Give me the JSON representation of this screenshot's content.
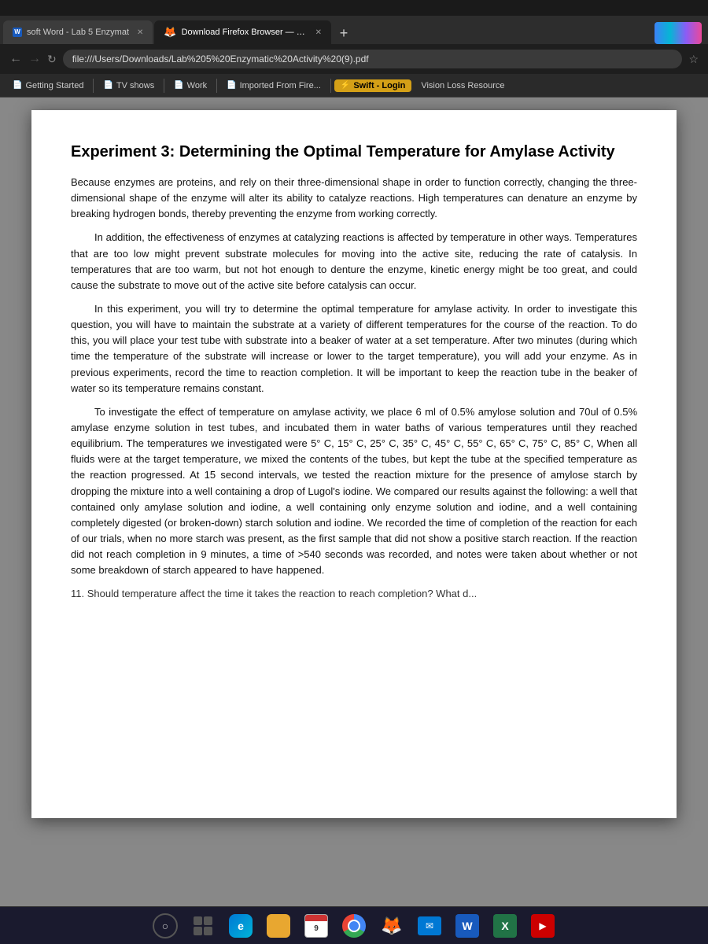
{
  "browser": {
    "tabs": [
      {
        "id": "tab1",
        "label": "soft Word - Lab 5 Enzymat",
        "active": false,
        "icon": "word-icon"
      },
      {
        "id": "tab2",
        "label": "Download Firefox Browser — Fas",
        "active": true,
        "icon": "firefox-icon"
      },
      {
        "id": "tab3",
        "label": "+",
        "active": false,
        "icon": ""
      }
    ],
    "address": "file:///Users/Downloads/Lab%205%20Enzymatic%20Activity%20(9).pdf",
    "bookmarks": [
      {
        "label": "Getting Started",
        "icon": "bookmark-icon"
      },
      {
        "label": "TV shows",
        "icon": "bookmark-icon"
      },
      {
        "label": "Work",
        "icon": "bookmark-icon"
      },
      {
        "label": "Imported From Fire...",
        "icon": "bookmark-icon"
      },
      {
        "label": "Swift - Login",
        "icon": "swift-icon"
      },
      {
        "label": "Vision Loss Resource",
        "icon": "bookmark-icon"
      }
    ]
  },
  "pdf": {
    "title": "Experiment 3:  Determining the Optimal Temperature for Amylase Activity",
    "paragraphs": [
      {
        "indent": false,
        "text": "Because enzymes are proteins, and rely on their three-dimensional shape in order to function correctly, changing the three-dimensional shape of the enzyme will alter its ability to catalyze reactions. High temperatures can denature an enzyme by breaking hydrogen bonds, thereby preventing the enzyme from working correctly."
      },
      {
        "indent": true,
        "text": "In addition, the effectiveness of enzymes at catalyzing reactions is affected by temperature in other ways. Temperatures that are too low might prevent substrate molecules for moving into the active site, reducing the rate of catalysis. In temperatures that are too warm, but not hot enough to denture the enzyme, kinetic energy might be too great, and could cause the substrate to move out of the active site before catalysis can occur."
      },
      {
        "indent": true,
        "text": "In this experiment, you will try to determine the optimal temperature for amylase activity. In order to investigate this question, you will have to maintain the substrate at a variety of different temperatures for the course of the reaction. To do this, you will place your test tube with substrate into a beaker of water at a set temperature. After two minutes (during which time the temperature of the substrate will increase or lower to the target temperature), you will add your enzyme. As in previous experiments, record the time to reaction completion. It will be important to keep the reaction tube in the beaker of water so its temperature remains constant."
      },
      {
        "indent": true,
        "text": "To investigate the effect of temperature on amylase activity, we place 6 ml of 0.5% amylose solution and 70ul of 0.5% amylase enzyme solution in test tubes, and incubated them in water baths of various temperatures until they reached equilibrium. The temperatures we investigated were 5° C, 15° C, 25° C, 35° C, 45° C, 55° C, 65° C, 75° C, 85° C,  When all fluids were at the target temperature, we mixed the contents of the tubes, but kept the tube at the specified temperature as the reaction progressed. At 15 second intervals, we tested the reaction mixture for the presence of amylose starch by dropping the mixture into a well containing a drop of Lugol's iodine. We compared our results against the following: a well that contained only amylase solution and iodine, a well containing only enzyme solution and iodine, and a well containing completely digested (or broken-down) starch solution and iodine. We recorded the time of completion of the reaction for each of our trials, when no more starch was present, as the first sample that did not show a positive starch reaction. If the reaction did not reach completion in 9 minutes, a time of >540 seconds was recorded, and notes were taken about whether or not some breakdown of starch appeared to have happened."
      }
    ],
    "cutoff_text": "11. Should temperature affect the time it takes the reaction to reach completion? What d..."
  },
  "taskbar": {
    "items": [
      {
        "name": "search",
        "type": "circle"
      },
      {
        "name": "taskview",
        "type": "taskview"
      },
      {
        "name": "edge",
        "type": "edge"
      },
      {
        "name": "files",
        "type": "files"
      },
      {
        "name": "calendar",
        "type": "calendar"
      },
      {
        "name": "chrome",
        "type": "chrome"
      },
      {
        "name": "firefox",
        "type": "firefox"
      },
      {
        "name": "mail",
        "type": "mail"
      },
      {
        "name": "word",
        "type": "word"
      },
      {
        "name": "excel",
        "type": "excel"
      },
      {
        "name": "app",
        "type": "app"
      }
    ]
  }
}
